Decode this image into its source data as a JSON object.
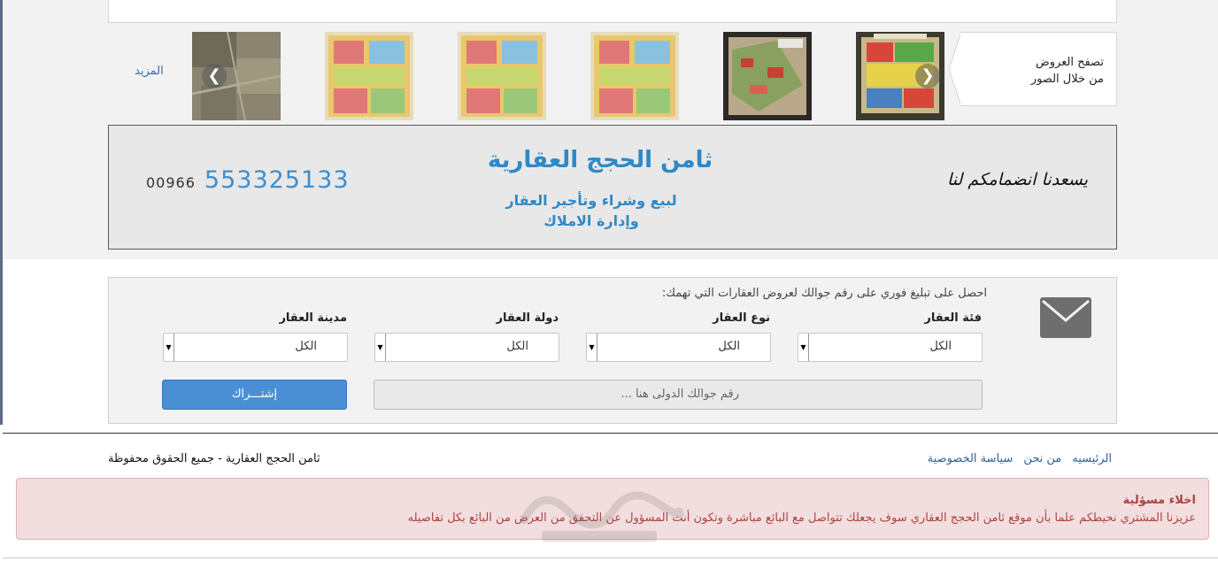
{
  "gallery": {
    "callout_line1": "تصفح العروض",
    "callout_line2": "من خلال الصور",
    "more_label": "المزيد",
    "prev_icon": "chevron-left-icon",
    "next_icon": "chevron-right-icon"
  },
  "banner": {
    "country_code": "00966",
    "phone": "553325133",
    "title": "ثامن الحجج العقارية",
    "subtitle_line1": "لبيع وشراء وتأجير العقار",
    "subtitle_line2": "وإدارة الاملاك",
    "welcome": "يسعدنا انضمامكم لنا"
  },
  "subscribe": {
    "intro": "احصل على تبليغ فوري على رقم جوالك لعروض العقارات التي تهمك:",
    "fields": [
      {
        "label": "فئة العقار",
        "value": "الكل"
      },
      {
        "label": "نوع العقار",
        "value": "الكل"
      },
      {
        "label": "دولة العقار",
        "value": "الكل"
      },
      {
        "label": "مدينة العقار",
        "value": "الكل"
      }
    ],
    "phone_placeholder": "رقم جوالك الدولى هنا ...",
    "button_label": "إشتـــراك",
    "icon": "envelope-icon",
    "accent_color": "#4a8fd4"
  },
  "footer": {
    "copyright": "ثامن الحجج العقارية - جميع الحقوق محفوظة",
    "links": [
      "الرئيسيه",
      "من نحن",
      "سياسة الخصوصية"
    ]
  },
  "disclaimer": {
    "title": "اخلاء مسؤلية",
    "body": "عزيزنا المشتري نحيطكم علما بأن موقع ثامن الحجج العقاري سوف يجعلك تتواصل مع البائع مباشرة وتكون أنت المسؤول عن التحقق من العرض من البائع بكل تفاصيله",
    "color": "#a94442"
  }
}
